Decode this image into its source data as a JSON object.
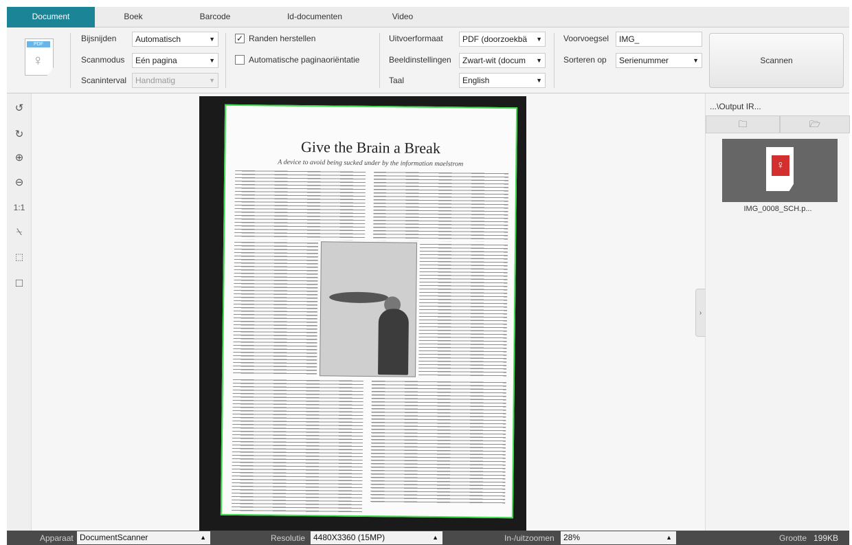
{
  "tabs": [
    "Document",
    "Boek",
    "Barcode",
    "Id-documenten",
    "Video"
  ],
  "options": {
    "pdf_badge": "PDF",
    "bijsnijden": {
      "label": "Bijsnijden",
      "value": "Automatisch"
    },
    "scanmodus": {
      "label": "Scanmodus",
      "value": "Eén pagina"
    },
    "scaninterval": {
      "label": "Scaninterval",
      "value": "Handmatig"
    },
    "randen_herstellen": {
      "label": "Randen herstellen",
      "checked": true
    },
    "auto_orientatie": {
      "label": "Automatische paginaoriëntatie",
      "checked": false
    },
    "uitvoerformaat": {
      "label": "Uitvoerformaat",
      "value": "PDF (doorzoekbä"
    },
    "beeldinstellingen": {
      "label": "Beeldinstellingen",
      "value": "Zwart-wit (docum"
    },
    "taal": {
      "label": "Taal",
      "value": "English"
    },
    "voorvoegsel": {
      "label": "Voorvoegsel",
      "value": "IMG_"
    },
    "sorteren_op": {
      "label": "Sorteren op",
      "value": "Serienummer"
    },
    "scan_button": "Scannen"
  },
  "preview": {
    "title": "Give the Brain a Break",
    "subtitle": "A device to avoid being sucked under by the information maelstrom"
  },
  "right_panel": {
    "output_path": "...\\Output IR...",
    "thumbnail_name": "IMG_0008_SCH.p..."
  },
  "status": {
    "apparaat": {
      "label": "Apparaat",
      "value": "DocumentScanner"
    },
    "resolutie": {
      "label": "Resolutie",
      "value": "4480X3360 (15MP)"
    },
    "zoom": {
      "label": "In-/uitzoomen",
      "value": "28%"
    },
    "grootte": {
      "label": "Grootte",
      "value": "199KB"
    }
  },
  "icons": [
    "pdf-file-icon",
    "rotate-left-icon",
    "rotate-right-icon",
    "zoom-in-icon",
    "zoom-out-icon",
    "actual-size-icon",
    "stamp-icon",
    "auto-crop-icon",
    "crop-frame-icon",
    "open-folder-icon",
    "folder-icon",
    "pdf-thumbnail-icon",
    "expand-panel-icon"
  ]
}
